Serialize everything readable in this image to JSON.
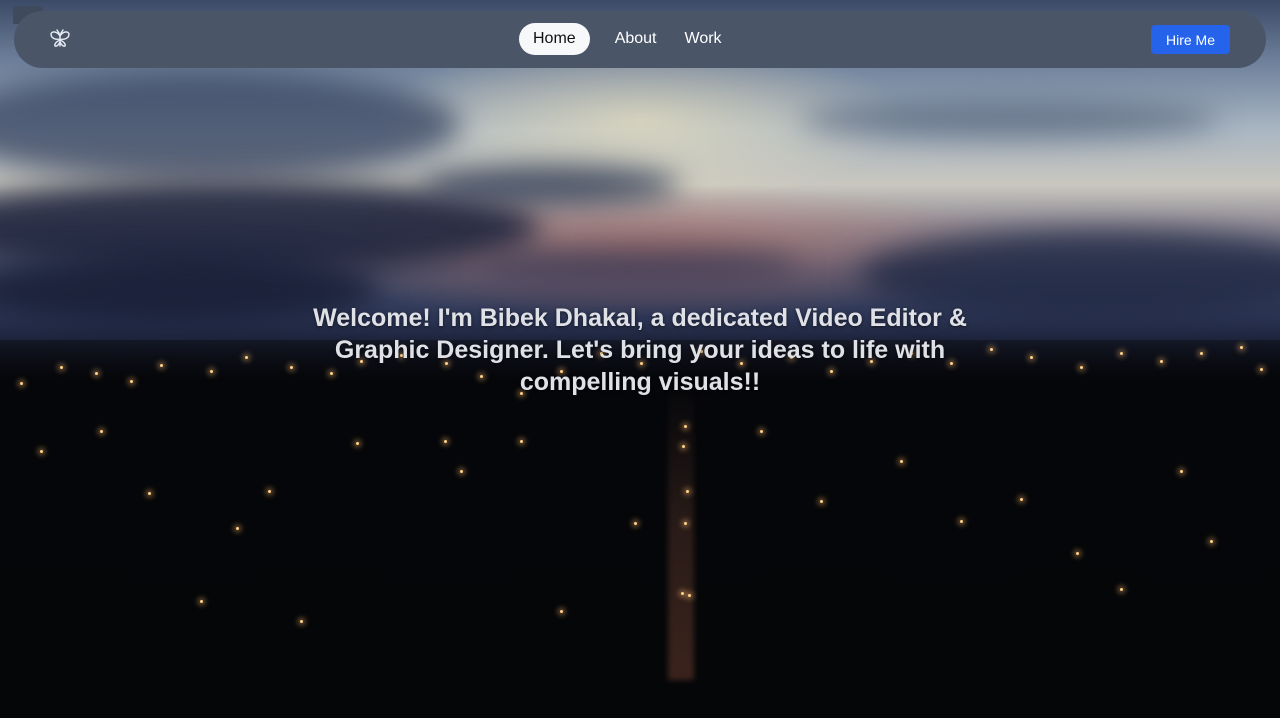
{
  "nav": {
    "logo": "butterfly-logo-icon",
    "links": [
      {
        "label": "Home",
        "active": true
      },
      {
        "label": "About",
        "active": false
      },
      {
        "label": "Work",
        "active": false
      }
    ],
    "cta_label": "Hire Me"
  },
  "hero": {
    "headline": "Welcome! I'm Bibek Dhakal, a dedicated Video Editor & Graphic Designer. Let's bring your ideas to life with compelling visuals!!"
  },
  "colors": {
    "navbar_bg": "#4a5568",
    "active_pill_bg": "#f7f8fa",
    "cta_bg": "#2563eb",
    "headline_text": "#dfe1e6"
  }
}
